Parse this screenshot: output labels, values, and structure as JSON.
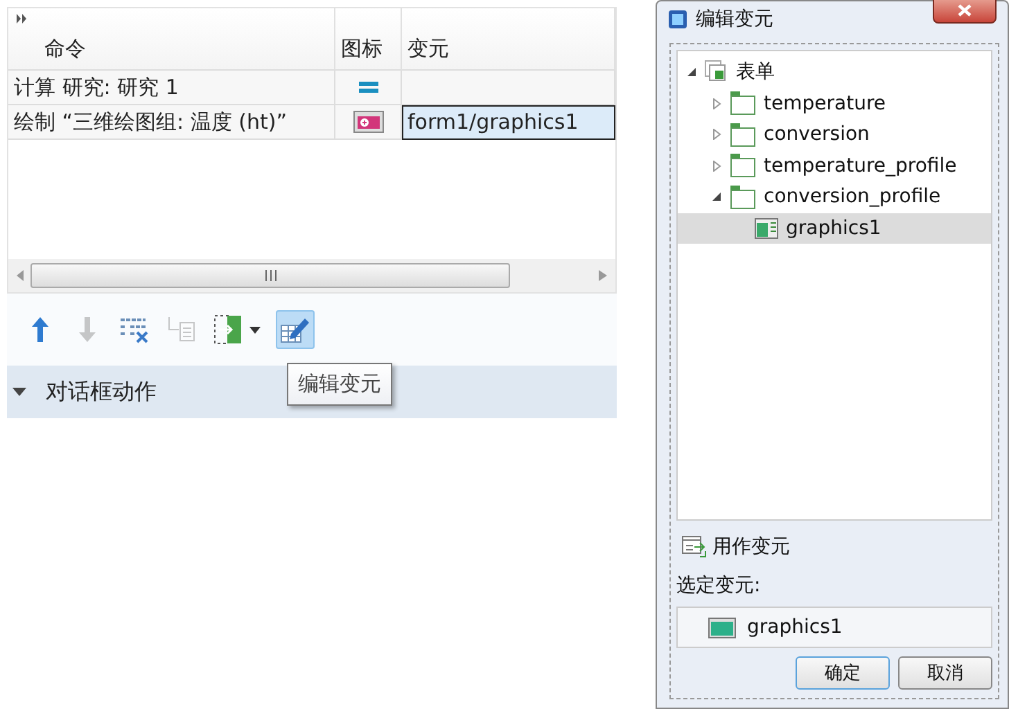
{
  "command_table": {
    "columns": [
      "命令",
      "图标",
      "变元"
    ],
    "rows": [
      {
        "command": "计算 研究: 研究 1",
        "kind": "compute",
        "argument": "",
        "selected": false
      },
      {
        "command": "绘制 “三维绘图组: 温度 (ht)”",
        "kind": "plot",
        "argument": "form1/graphics1",
        "selected": true
      }
    ]
  },
  "toolbar": [
    {
      "kind": "move-up",
      "disabled": false,
      "pressed": false
    },
    {
      "kind": "move-down",
      "disabled": true,
      "pressed": false
    },
    {
      "kind": "delete",
      "disabled": false,
      "pressed": false
    },
    {
      "kind": "insert",
      "disabled": true,
      "pressed": false
    },
    {
      "kind": "import",
      "disabled": false,
      "pressed": false
    },
    {
      "kind": "edit-argument",
      "disabled": false,
      "pressed": true
    }
  ],
  "tooltip": "编辑变元",
  "section": {
    "label": "对话框动作",
    "expanded": true
  },
  "dialog": {
    "title": "编辑变元",
    "tree": [
      {
        "label": "表单",
        "kind": "forms",
        "expanded": true,
        "selected": false,
        "children": [
          {
            "label": "temperature",
            "kind": "form",
            "expanded": false,
            "selected": false
          },
          {
            "label": "conversion",
            "kind": "form",
            "expanded": false,
            "selected": false
          },
          {
            "label": "temperature_profile",
            "kind": "form",
            "expanded": false,
            "selected": false
          },
          {
            "label": "conversion_profile",
            "kind": "form",
            "expanded": true,
            "selected": false,
            "children": [
              {
                "label": "graphics1",
                "kind": "graphics",
                "selected": true
              }
            ]
          }
        ]
      }
    ],
    "use_button": "用作变元",
    "selected_label": "选定变元:",
    "selected_value": "graphics1",
    "buttons": [
      {
        "label": "确定",
        "default": true
      },
      {
        "label": "取消",
        "default": false
      }
    ]
  }
}
